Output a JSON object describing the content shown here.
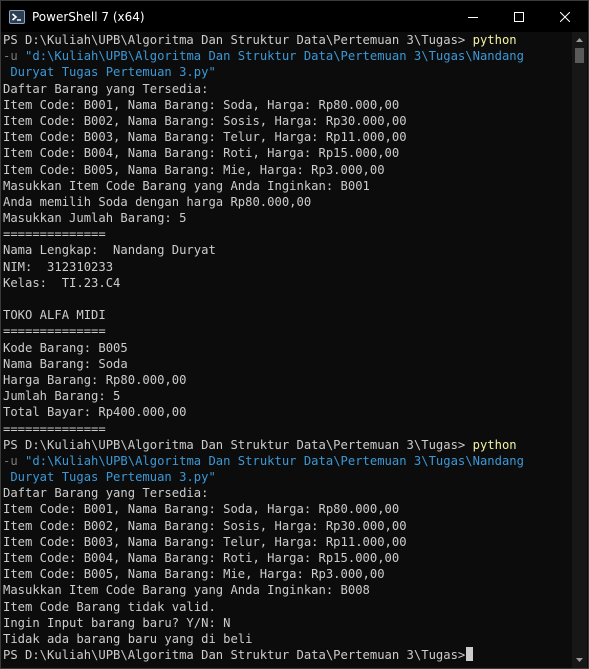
{
  "window": {
    "title": "PowerShell 7 (x64)",
    "icon": "powershell-icon",
    "controls": [
      "minimize-icon",
      "maximize-icon",
      "close-icon"
    ]
  },
  "colors": {
    "background": "#0c0c0c",
    "text": "#cccccc",
    "command": "#f2f2a0",
    "parameter": "#7a7a7a",
    "string": "#3b98d6"
  },
  "terminal": {
    "lines": [
      [
        {
          "t": "PS D:\\Kuliah\\UPB\\Algoritma Dan Struktur Data\\Pertemuan 3\\Tugas> ",
          "c": ""
        },
        {
          "t": "python",
          "c": "cmd"
        }
      ],
      [
        {
          "t": "-u ",
          "c": "param"
        },
        {
          "t": "\"d:\\Kuliah\\UPB\\Algoritma Dan Struktur Data\\Pertemuan 3\\Tugas\\Nandang",
          "c": "str"
        }
      ],
      [
        {
          "t": " Duryat Tugas Pertemuan 3.py\"",
          "c": "str"
        }
      ],
      [
        {
          "t": "Daftar Barang yang Tersedia:",
          "c": ""
        }
      ],
      [
        {
          "t": "Item Code: B001, Nama Barang: Soda, Harga: Rp80.000,00",
          "c": ""
        }
      ],
      [
        {
          "t": "Item Code: B002, Nama Barang: Sosis, Harga: Rp30.000,00",
          "c": ""
        }
      ],
      [
        {
          "t": "Item Code: B003, Nama Barang: Telur, Harga: Rp11.000,00",
          "c": ""
        }
      ],
      [
        {
          "t": "Item Code: B004, Nama Barang: Roti, Harga: Rp15.000,00",
          "c": ""
        }
      ],
      [
        {
          "t": "Item Code: B005, Nama Barang: Mie, Harga: Rp3.000,00",
          "c": ""
        }
      ],
      [
        {
          "t": "Masukkan Item Code Barang yang Anda Inginkan: B001",
          "c": ""
        }
      ],
      [
        {
          "t": "Anda memilih Soda dengan harga Rp80.000,00",
          "c": ""
        }
      ],
      [
        {
          "t": "Masukkan Jumlah Barang: 5",
          "c": ""
        }
      ],
      [
        {
          "t": "==============",
          "c": ""
        }
      ],
      [
        {
          "t": "Nama Lengkap:  Nandang Duryat",
          "c": ""
        }
      ],
      [
        {
          "t": "NIM:  312310233",
          "c": ""
        }
      ],
      [
        {
          "t": "Kelas:  TI.23.C4",
          "c": ""
        }
      ],
      [
        {
          "t": "",
          "c": ""
        }
      ],
      [
        {
          "t": "TOKO ALFA MIDI",
          "c": ""
        }
      ],
      [
        {
          "t": "==============",
          "c": ""
        }
      ],
      [
        {
          "t": "Kode Barang: B005",
          "c": ""
        }
      ],
      [
        {
          "t": "Nama Barang: Soda",
          "c": ""
        }
      ],
      [
        {
          "t": "Harga Barang: Rp80.000,00",
          "c": ""
        }
      ],
      [
        {
          "t": "Jumlah Barang: 5",
          "c": ""
        }
      ],
      [
        {
          "t": "Total Bayar: Rp400.000,00",
          "c": ""
        }
      ],
      [
        {
          "t": "==============",
          "c": ""
        }
      ],
      [
        {
          "t": "PS D:\\Kuliah\\UPB\\Algoritma Dan Struktur Data\\Pertemuan 3\\Tugas> ",
          "c": ""
        },
        {
          "t": "python",
          "c": "cmd"
        }
      ],
      [
        {
          "t": "-u ",
          "c": "param"
        },
        {
          "t": "\"d:\\Kuliah\\UPB\\Algoritma Dan Struktur Data\\Pertemuan 3\\Tugas\\Nandang",
          "c": "str"
        }
      ],
      [
        {
          "t": " Duryat Tugas Pertemuan 3.py\"",
          "c": "str"
        }
      ],
      [
        {
          "t": "Daftar Barang yang Tersedia:",
          "c": ""
        }
      ],
      [
        {
          "t": "Item Code: B001, Nama Barang: Soda, Harga: Rp80.000,00",
          "c": ""
        }
      ],
      [
        {
          "t": "Item Code: B002, Nama Barang: Sosis, Harga: Rp30.000,00",
          "c": ""
        }
      ],
      [
        {
          "t": "Item Code: B003, Nama Barang: Telur, Harga: Rp11.000,00",
          "c": ""
        }
      ],
      [
        {
          "t": "Item Code: B004, Nama Barang: Roti, Harga: Rp15.000,00",
          "c": ""
        }
      ],
      [
        {
          "t": "Item Code: B005, Nama Barang: Mie, Harga: Rp3.000,00",
          "c": ""
        }
      ],
      [
        {
          "t": "Masukkan Item Code Barang yang Anda Inginkan: B008",
          "c": ""
        }
      ],
      [
        {
          "t": "Item Code Barang tidak valid.",
          "c": ""
        }
      ],
      [
        {
          "t": "Ingin Input barang baru? Y/N: N",
          "c": ""
        }
      ],
      [
        {
          "t": "Tidak ada barang baru yang di beli",
          "c": ""
        }
      ],
      [
        {
          "t": "PS D:\\Kuliah\\UPB\\Algoritma Dan Struktur Data\\Pertemuan 3\\Tugas>",
          "c": ""
        }
      ]
    ]
  }
}
